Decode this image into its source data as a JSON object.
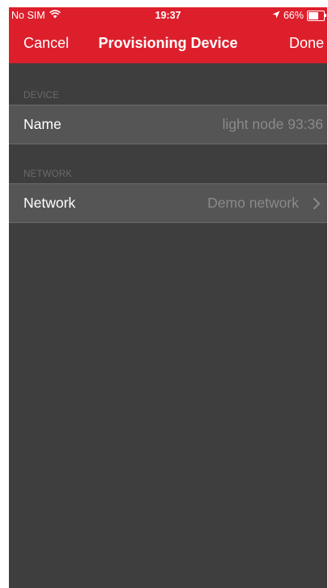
{
  "status_bar": {
    "carrier": "No SIM",
    "time": "19:37",
    "battery_text": "66%",
    "battery_level": 0.66,
    "icons": [
      "wifi-icon",
      "location-arrow-icon",
      "battery-icon"
    ]
  },
  "nav": {
    "cancel_label": "Cancel",
    "title": "Provisioning Device",
    "done_label": "Done"
  },
  "sections": {
    "device": {
      "header": "DEVICE",
      "name_label": "Name",
      "name_value": "light node 93:36"
    },
    "network": {
      "header": "NETWORK",
      "network_label": "Network",
      "network_value": "Demo network",
      "chevron_icon": "chevron-right-icon"
    }
  },
  "colors": {
    "accent_red": "#dd1f2c",
    "background": "#3e3e3e",
    "cell_background": "#555555",
    "secondary_text": "#8a8a8a",
    "section_header_text": "#6a6a6a"
  }
}
